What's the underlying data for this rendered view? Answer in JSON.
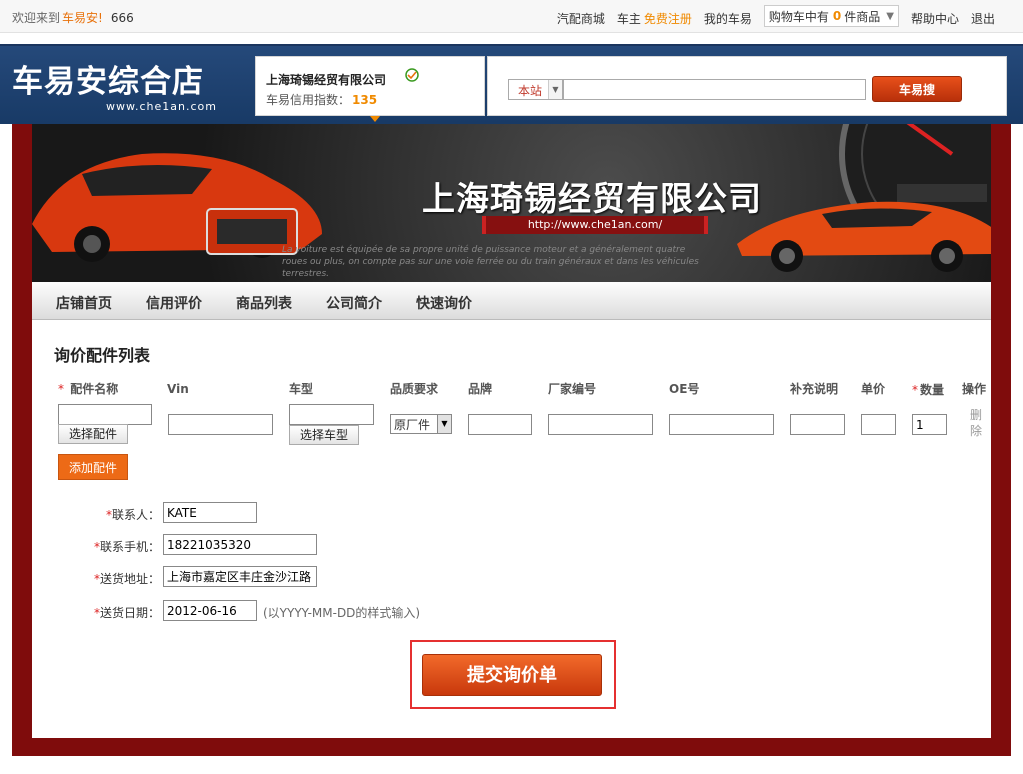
{
  "topbar": {
    "welcome": "欢迎来到",
    "brand": "车易安!",
    "username": "666",
    "links": [
      "汽配商城",
      "车主"
    ],
    "register": "免费注册",
    "my_account": "我的车易",
    "cart_prefix": "购物车中有",
    "cart_count": "0",
    "cart_suffix": "件商品",
    "help": "帮助中心",
    "logout": "退出"
  },
  "header": {
    "logo_main": "车易安综合店",
    "logo_sub": "www.che1an.com",
    "company_name": "上海琦锡经贸有限公司",
    "credit_label": "车易信用指数：",
    "credit_value": "135",
    "search_scope": "本站",
    "search_value": "",
    "search_button": "车易搜"
  },
  "banner": {
    "title": "上海琦锡经贸有限公司",
    "url": "http://www.che1an.com/",
    "tagline": "La voiture est équipée de sa propre unité de puissance moteur et a généralement quatre roues ou plus, on compte pas sur une voie ferrée ou du train généraux et dans les véhicules terrestres."
  },
  "nav": {
    "items": [
      "店铺首页",
      "信用评价",
      "商品列表",
      "公司简介",
      "快速询价"
    ]
  },
  "inquiry": {
    "title": "询价配件列表",
    "columns": {
      "part_name": "配件名称",
      "vin": "Vin",
      "model": "车型",
      "quality": "品质要求",
      "brand": "品牌",
      "maker_no": "厂家编号",
      "oe": "OE号",
      "remark": "补充说明",
      "price": "单价",
      "qty": "数量",
      "action": "操作"
    },
    "row": {
      "part_name": "",
      "vin": "",
      "model": "",
      "quality": "原厂件",
      "brand": "",
      "maker_no": "",
      "oe": "",
      "remark": "",
      "price": "",
      "qty": "1",
      "delete": "删除"
    },
    "select_part_btn": "选择配件",
    "select_model_btn": "选择车型",
    "add_part_btn": "添加配件"
  },
  "form": {
    "contact_label": "联系人：",
    "contact_value": "KATE",
    "phone_label": "联系手机：",
    "phone_value": "18221035320",
    "address_label": "送货地址：",
    "address_value": "上海市嘉定区丰庄金沙江路",
    "date_label": "送货日期：",
    "date_value": "2012-06-16",
    "date_hint": "(以YYYY-MM-DD的样式输入)",
    "required_mark": "*"
  },
  "submit": {
    "label": "提交询价单"
  },
  "colors": {
    "frame": "#7f0c0c",
    "accent_orange": "#ed6a16",
    "header_blue": "#1f4474",
    "highlight_red": "#e53030"
  }
}
